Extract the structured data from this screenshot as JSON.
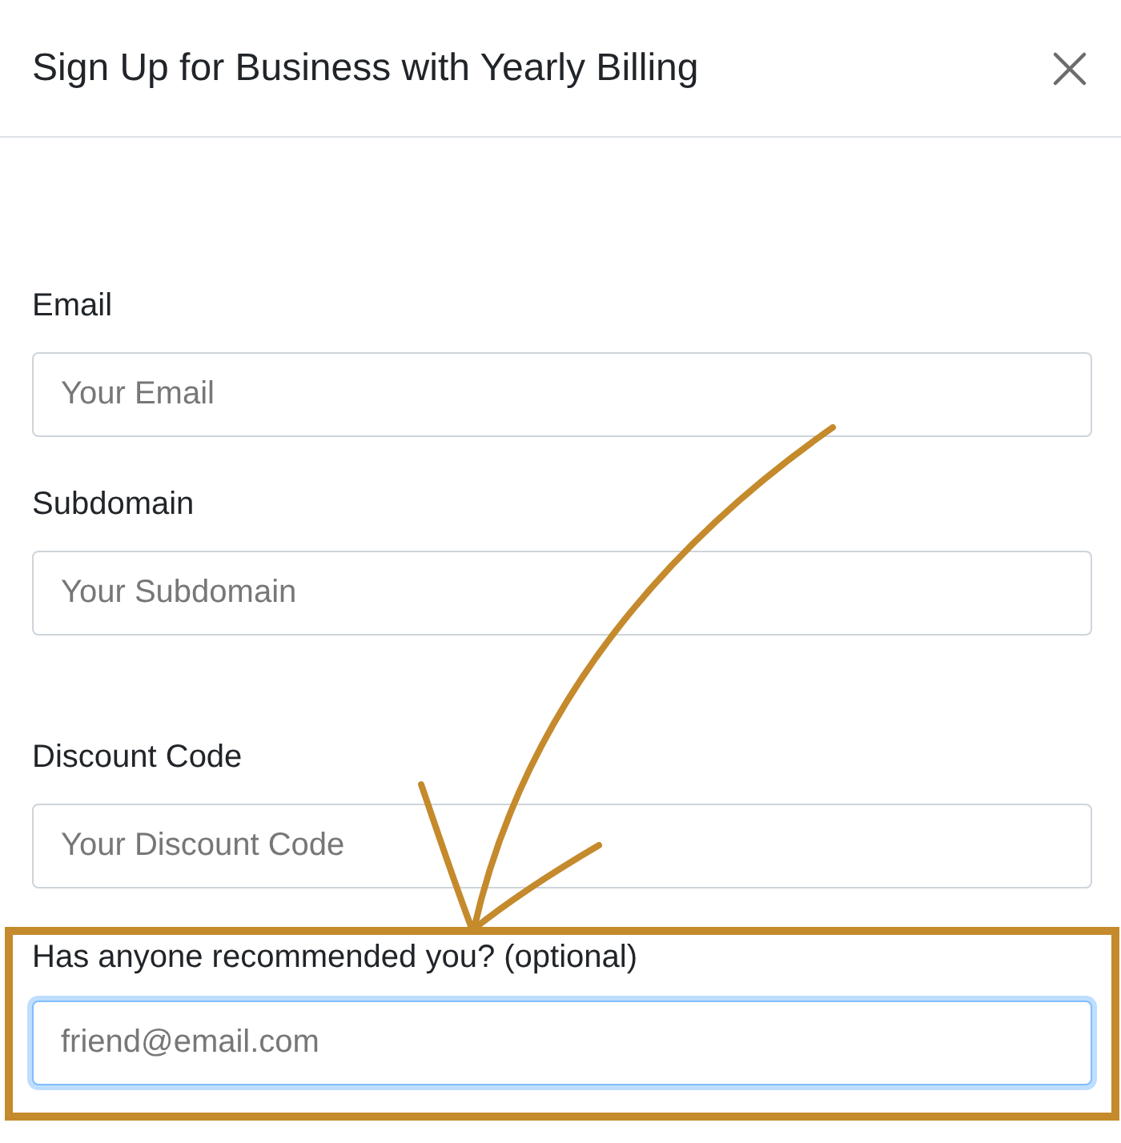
{
  "dialog": {
    "title": "Sign Up for Business with Yearly Billing"
  },
  "fields": [
    {
      "label": "Email",
      "placeholder": "Your Email",
      "focused": false,
      "highlighted": false
    },
    {
      "label": "Subdomain",
      "placeholder": "Your Subdomain",
      "focused": false,
      "highlighted": false
    },
    {
      "label": "Discount Code",
      "placeholder": "Your Discount Code",
      "focused": false,
      "highlighted": false
    },
    {
      "label": "Has anyone recommended you? (optional)",
      "placeholder": "friend@email.com",
      "focused": true,
      "highlighted": true
    }
  ]
}
